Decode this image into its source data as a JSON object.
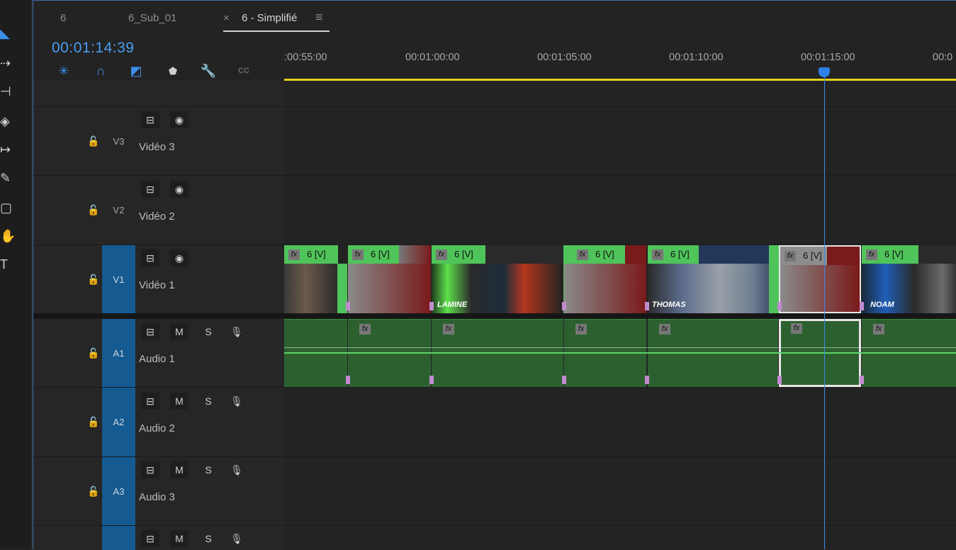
{
  "tabs": [
    {
      "label": "6"
    },
    {
      "label": "6_Sub_01"
    },
    {
      "label": "6 - Simplifié",
      "close": "×",
      "menu": "≡"
    }
  ],
  "timecode": "00:01:14:39",
  "controls": [
    "nest-icon",
    "snap-magnet-icon",
    "linked-selection-icon",
    "add-marker-icon",
    "settings-wrench-icon",
    "captions-cc-icon"
  ],
  "controls_text": {
    "cc": "CC"
  },
  "ruler": {
    "labels": [
      ":00:55:00",
      "00:01:00:00",
      "00:01:05:00",
      "00:01:10:00",
      "00:01:15:00",
      "00:0"
    ]
  },
  "tracks": {
    "video": [
      {
        "id": "V3",
        "name": "Vidéo 3"
      },
      {
        "id": "V2",
        "name": "Vidéo 2"
      },
      {
        "id": "V1",
        "name": "Vidéo 1"
      }
    ],
    "audio": [
      {
        "id": "A1",
        "name": "Audio 1",
        "m": "M",
        "s": "S"
      },
      {
        "id": "A2",
        "name": "Audio 2",
        "m": "M",
        "s": "S"
      },
      {
        "id": "A3",
        "name": "Audio 3",
        "m": "M",
        "s": "S"
      },
      {
        "id": "",
        "name": "",
        "m": "M",
        "s": "S"
      }
    ]
  },
  "clips": [
    {
      "label": "6 [V]",
      "fx": "fx",
      "title": ""
    },
    {
      "label": "6 [V]",
      "fx": "fx",
      "title": ""
    },
    {
      "label": "6 [V]",
      "fx": "fx",
      "title": "LAMINE"
    },
    {
      "label": "6 [V]",
      "fx": "fx",
      "title": ""
    },
    {
      "label": "6 [V]",
      "fx": "fx",
      "title": "THOMAS"
    },
    {
      "label": "6 [V]",
      "fx": "fx",
      "title": ""
    },
    {
      "label": "6 [V]",
      "fx": "fx",
      "title": "NOAM"
    }
  ],
  "colors": {
    "accent": "#4a9cf0",
    "clip": "#4fc45a",
    "audio": "#2c612f",
    "patch": "#155a91",
    "workarea": "#e5d21b"
  }
}
